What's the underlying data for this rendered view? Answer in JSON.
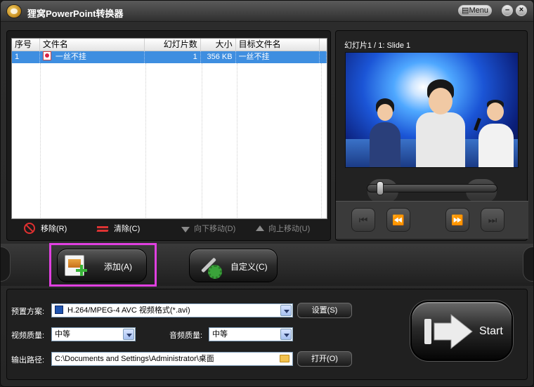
{
  "window": {
    "title": "狸窝PowerPoint转换器",
    "menu_label": "Menu",
    "minimize_label": "–",
    "close_label": "×"
  },
  "file_list": {
    "columns": [
      "序号",
      "文件名",
      "幻灯片数",
      "大小",
      "目标文件名"
    ],
    "rows": [
      {
        "index": "1",
        "file_name": "一丝不挂",
        "slides": "1",
        "size": "356 KB",
        "target": "一丝不挂"
      }
    ]
  },
  "list_toolbar": {
    "remove": "移除(R)",
    "clear": "清除(C)",
    "move_down": "向下移动(D)",
    "move_up": "向上移动(U)"
  },
  "preview": {
    "label": "幻灯片1 / 1: Slide 1",
    "seek_position": 0.06
  },
  "actions": {
    "add": "添加(A)",
    "customize": "自定义(C)"
  },
  "settings": {
    "preset_label": "预置方案:",
    "preset_value": "H.264/MPEG-4 AVC 视频格式(*.avi)",
    "settings_button": "设置(S)",
    "video_quality_label": "视频质量:",
    "video_quality_value": "中等",
    "audio_quality_label": "音频质量:",
    "audio_quality_value": "中等",
    "output_path_label": "输出路径:",
    "output_path_value": "C:\\Documents and Settings\\Administrator\\桌面",
    "open_button": "打开(O)",
    "start_button": "Start"
  },
  "colors": {
    "selection": "#3e8ee0",
    "highlight_box": "#e040e0",
    "accent_green": "#38b338"
  }
}
